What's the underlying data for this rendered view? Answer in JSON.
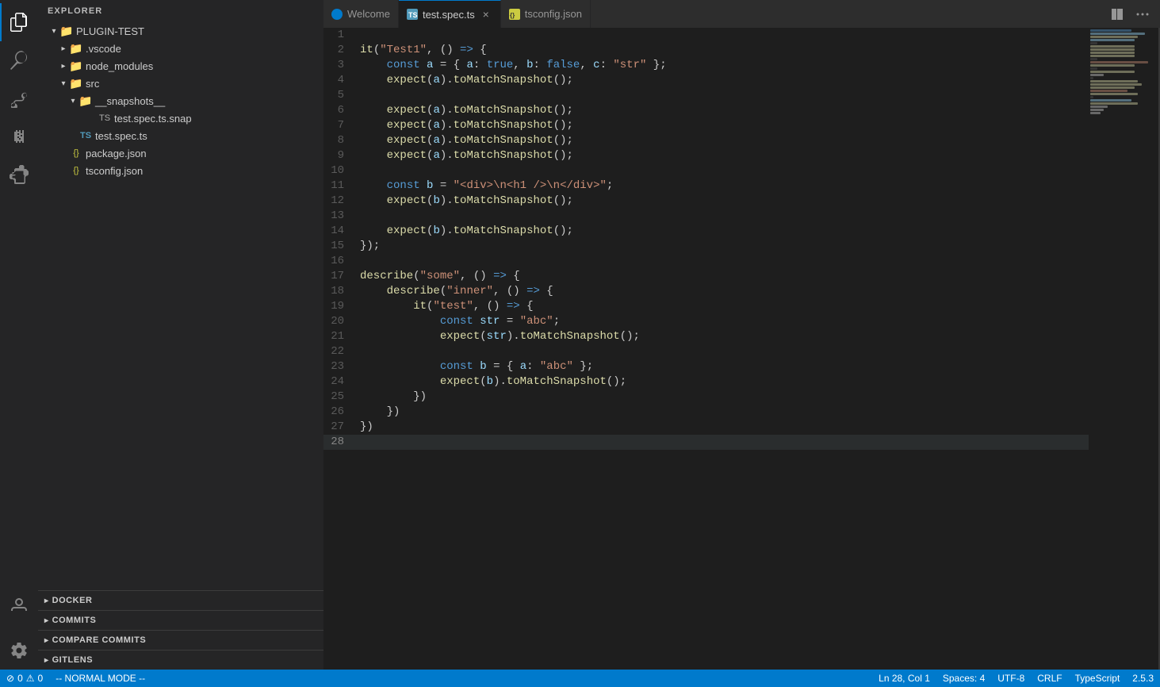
{
  "activityBar": {
    "items": [
      {
        "id": "explorer",
        "icon": "files-icon",
        "active": true
      },
      {
        "id": "search",
        "icon": "search-icon",
        "active": false
      },
      {
        "id": "source-control",
        "icon": "source-control-icon",
        "active": false
      },
      {
        "id": "run",
        "icon": "run-icon",
        "active": false
      },
      {
        "id": "extensions",
        "icon": "extensions-icon",
        "active": false
      }
    ],
    "bottomItems": [
      {
        "id": "accounts",
        "icon": "accounts-icon"
      },
      {
        "id": "settings",
        "icon": "settings-icon"
      }
    ]
  },
  "sidebar": {
    "title": "EXPLORER",
    "root": "PLUGIN-TEST",
    "tree": [
      {
        "id": "plugin-test",
        "label": "PLUGIN-TEST",
        "type": "root",
        "indent": 0,
        "open": true
      },
      {
        "id": "vscode",
        "label": ".vscode",
        "type": "folder",
        "indent": 1,
        "open": false
      },
      {
        "id": "node_modules",
        "label": "node_modules",
        "type": "folder",
        "indent": 1,
        "open": false
      },
      {
        "id": "src",
        "label": "src",
        "type": "folder",
        "indent": 1,
        "open": true
      },
      {
        "id": "snapshots",
        "label": "__snapshots__",
        "type": "folder",
        "indent": 2,
        "open": true
      },
      {
        "id": "snap-file",
        "label": "test.spec.ts.snap",
        "type": "file-snap",
        "indent": 3
      },
      {
        "id": "test-spec",
        "label": "test.spec.ts",
        "type": "file-ts",
        "indent": 2
      },
      {
        "id": "package-json",
        "label": "package.json",
        "type": "file-json",
        "indent": 1
      },
      {
        "id": "tsconfig",
        "label": "tsconfig.json",
        "type": "file-json",
        "indent": 1
      }
    ],
    "bottomSections": [
      {
        "id": "docker",
        "label": "DOCKER",
        "open": false
      },
      {
        "id": "commits",
        "label": "COMMITS",
        "open": false
      },
      {
        "id": "compare-commits",
        "label": "COMPARE COMMITS",
        "open": false
      },
      {
        "id": "gitlens",
        "label": "GITLENS",
        "open": false
      }
    ]
  },
  "tabs": [
    {
      "id": "welcome",
      "label": "Welcome",
      "icon": "welcome-icon",
      "active": false,
      "closeable": false
    },
    {
      "id": "test-spec",
      "label": "test.spec.ts",
      "icon": "ts-icon",
      "active": true,
      "closeable": true
    },
    {
      "id": "tsconfig",
      "label": "tsconfig.json",
      "icon": "json-icon",
      "active": false,
      "closeable": false
    }
  ],
  "editor": {
    "lines": [
      {
        "num": 1,
        "content": "",
        "tokens": []
      },
      {
        "num": 2,
        "text": "it(\"Test1\", () => {"
      },
      {
        "num": 3,
        "text": "    const a = { a: true, b: false, c: \"str\" };"
      },
      {
        "num": 4,
        "text": "    expect(a).toMatchSnapshot();"
      },
      {
        "num": 5,
        "text": ""
      },
      {
        "num": 6,
        "text": "    expect(a).toMatchSnapshot();"
      },
      {
        "num": 7,
        "text": "    expect(a).toMatchSnapshot();"
      },
      {
        "num": 8,
        "text": "    expect(a).toMatchSnapshot();"
      },
      {
        "num": 9,
        "text": "    expect(a).toMatchSnapshot();"
      },
      {
        "num": 10,
        "text": ""
      },
      {
        "num": 11,
        "text": "    const b = \"<div>\\n<h1 />\\n</div>\";"
      },
      {
        "num": 12,
        "text": "    expect(b).toMatchSnapshot();"
      },
      {
        "num": 13,
        "text": ""
      },
      {
        "num": 14,
        "text": "    expect(b).toMatchSnapshot();"
      },
      {
        "num": 15,
        "text": "});"
      },
      {
        "num": 16,
        "text": ""
      },
      {
        "num": 17,
        "text": "describe(\"some\", () => {"
      },
      {
        "num": 18,
        "text": "    describe(\"inner\", () => {"
      },
      {
        "num": 19,
        "text": "        it(\"test\", () => {"
      },
      {
        "num": 20,
        "text": "            const str = \"abc\";"
      },
      {
        "num": 21,
        "text": "            expect(str).toMatchSnapshot();"
      },
      {
        "num": 22,
        "text": ""
      },
      {
        "num": 23,
        "text": "            const b = { a: \"abc\" };"
      },
      {
        "num": 24,
        "text": "            expect(b).toMatchSnapshot();"
      },
      {
        "num": 25,
        "text": "        })"
      },
      {
        "num": 26,
        "text": "    })"
      },
      {
        "num": 27,
        "text": "})"
      },
      {
        "num": 28,
        "text": ""
      }
    ]
  },
  "statusBar": {
    "left": [
      {
        "id": "errors",
        "icon": "error-icon",
        "text": "0"
      },
      {
        "id": "warnings",
        "icon": "warning-icon",
        "text": "0"
      },
      {
        "id": "mode",
        "text": "-- NORMAL MODE --"
      }
    ],
    "right": [
      {
        "id": "position",
        "text": "Ln 28, Col 1"
      },
      {
        "id": "spaces",
        "text": "Spaces: 4"
      },
      {
        "id": "encoding",
        "text": "UTF-8"
      },
      {
        "id": "eol",
        "text": "CRLF"
      },
      {
        "id": "language",
        "text": "TypeScript"
      },
      {
        "id": "version",
        "text": "2.5.3"
      }
    ]
  }
}
